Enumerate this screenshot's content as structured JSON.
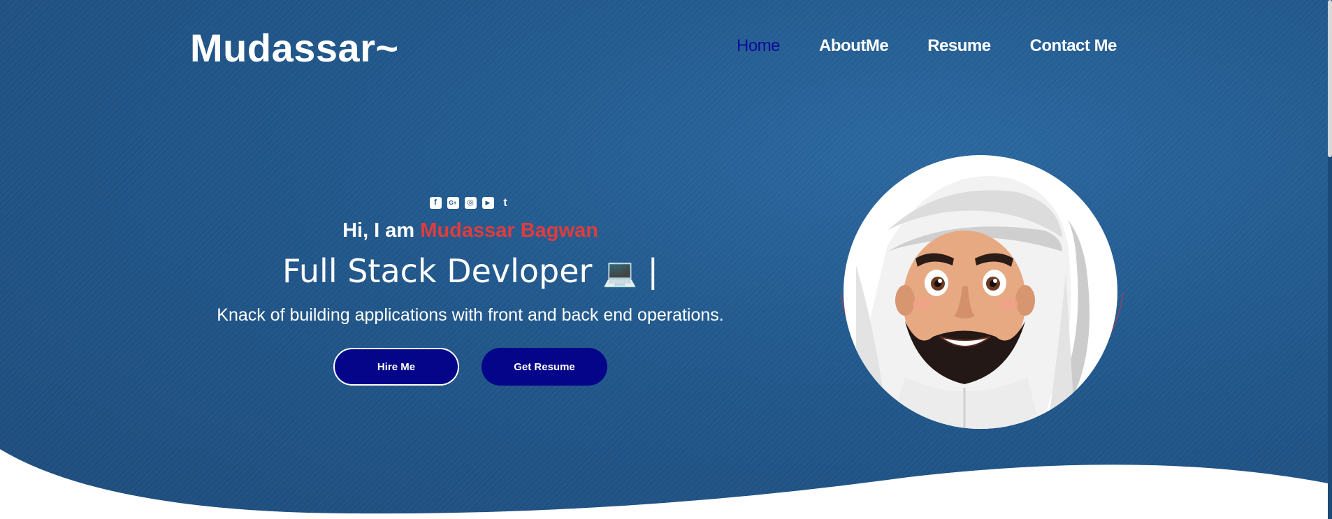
{
  "brand": {
    "logo": "Mudassar~"
  },
  "nav": {
    "items": [
      {
        "label": "Home",
        "active": true
      },
      {
        "label": "AboutMe",
        "active": false
      },
      {
        "label": "Resume",
        "active": false
      },
      {
        "label": "Contact Me",
        "active": false
      }
    ]
  },
  "hero": {
    "socials": [
      {
        "icon": "facebook-icon",
        "glyph": "f"
      },
      {
        "icon": "google-plus-icon",
        "glyph": "G+"
      },
      {
        "icon": "instagram-icon",
        "glyph": "◎"
      },
      {
        "icon": "youtube-icon",
        "glyph": "▶"
      },
      {
        "icon": "twitter-icon",
        "glyph": "t"
      }
    ],
    "greeting_prefix": "Hi, I am",
    "name": "Mudassar Bagwan",
    "role": "Full Stack Devloper",
    "role_emoji": "💻",
    "cursor": "|",
    "tagline": "Knack of building applications with front and back end operations.",
    "hire_label": "Hire Me",
    "resume_label": "Get Resume"
  },
  "colors": {
    "background": "#20578c",
    "accent_name": "#e03c3c",
    "button": "#05058a",
    "nav_active": "#0b0b9a"
  }
}
